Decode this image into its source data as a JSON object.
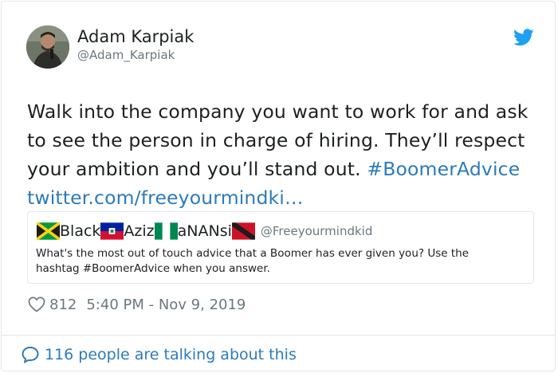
{
  "author": {
    "name": "Adam Karpiak",
    "handle": "@Adam_Karpiak"
  },
  "tweet": {
    "text": "Walk into the company you want to work for and ask to see the person in charge of hiring. They’ll respect your ambition and you’ll stand out.",
    "hashtag": "#BoomerAdvice",
    "link": "twitter.com/freeyourmindki…"
  },
  "quoted": {
    "name_parts": [
      "Black",
      "Aziz",
      "aNANsi"
    ],
    "flags": [
      "jamaica-flag-icon",
      "haiti-flag-icon",
      "nigeria-flag-icon",
      "trinidad-tobago-flag-icon"
    ],
    "handle": "@Freeyourmindkid",
    "text": "What's the most out of touch advice that a Boomer has ever given you? Use the hashtag #BoomerAdvice when you answer."
  },
  "meta": {
    "likes": "812",
    "timestamp": "5:40 PM - Nov 9, 2019"
  },
  "footer": {
    "talking": "116 people are talking about this"
  },
  "colors": {
    "link": "#2b7bb9",
    "muted": "#697882",
    "twitter_blue": "#1da1f2",
    "border": "#e1e8ed"
  }
}
